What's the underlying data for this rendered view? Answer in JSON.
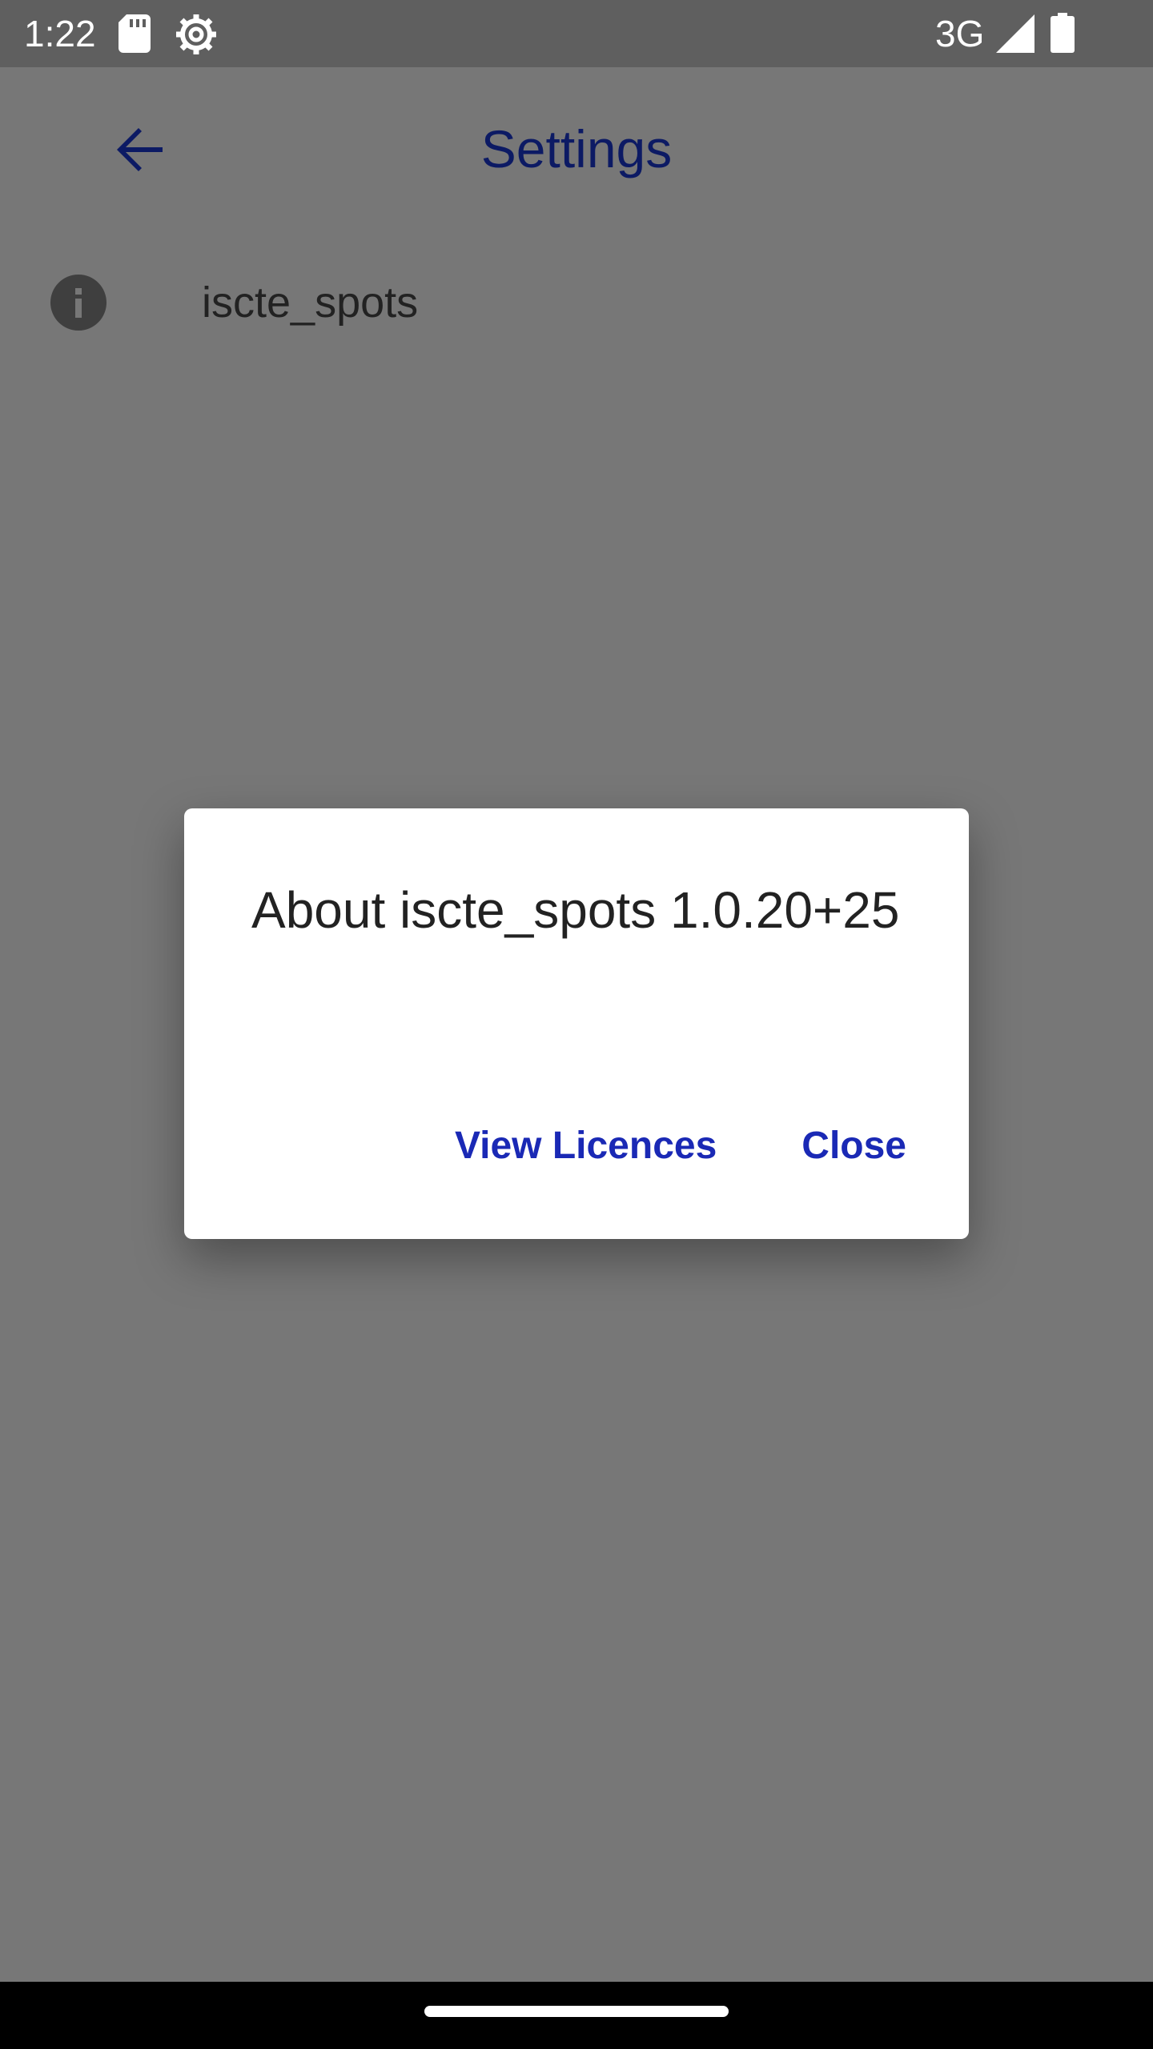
{
  "status_bar": {
    "time": "1:22",
    "network": "3G",
    "icons": [
      "sd-card-icon",
      "gear-icon",
      "signal-icon",
      "battery-icon"
    ]
  },
  "app_bar": {
    "title": "Settings",
    "back_icon": "arrow-back-icon"
  },
  "settings": {
    "items": [
      {
        "icon": "info-icon",
        "label": "iscte_spots"
      }
    ]
  },
  "dialog": {
    "title": "About iscte_spots 1.0.20+25",
    "view_licences_label": "View Licences",
    "close_label": "Close"
  },
  "colors": {
    "scrim": "#777777",
    "accent": "#1a29b5",
    "title_dimmed": "#0c1a64",
    "status_bar": "#5f5f5f"
  }
}
